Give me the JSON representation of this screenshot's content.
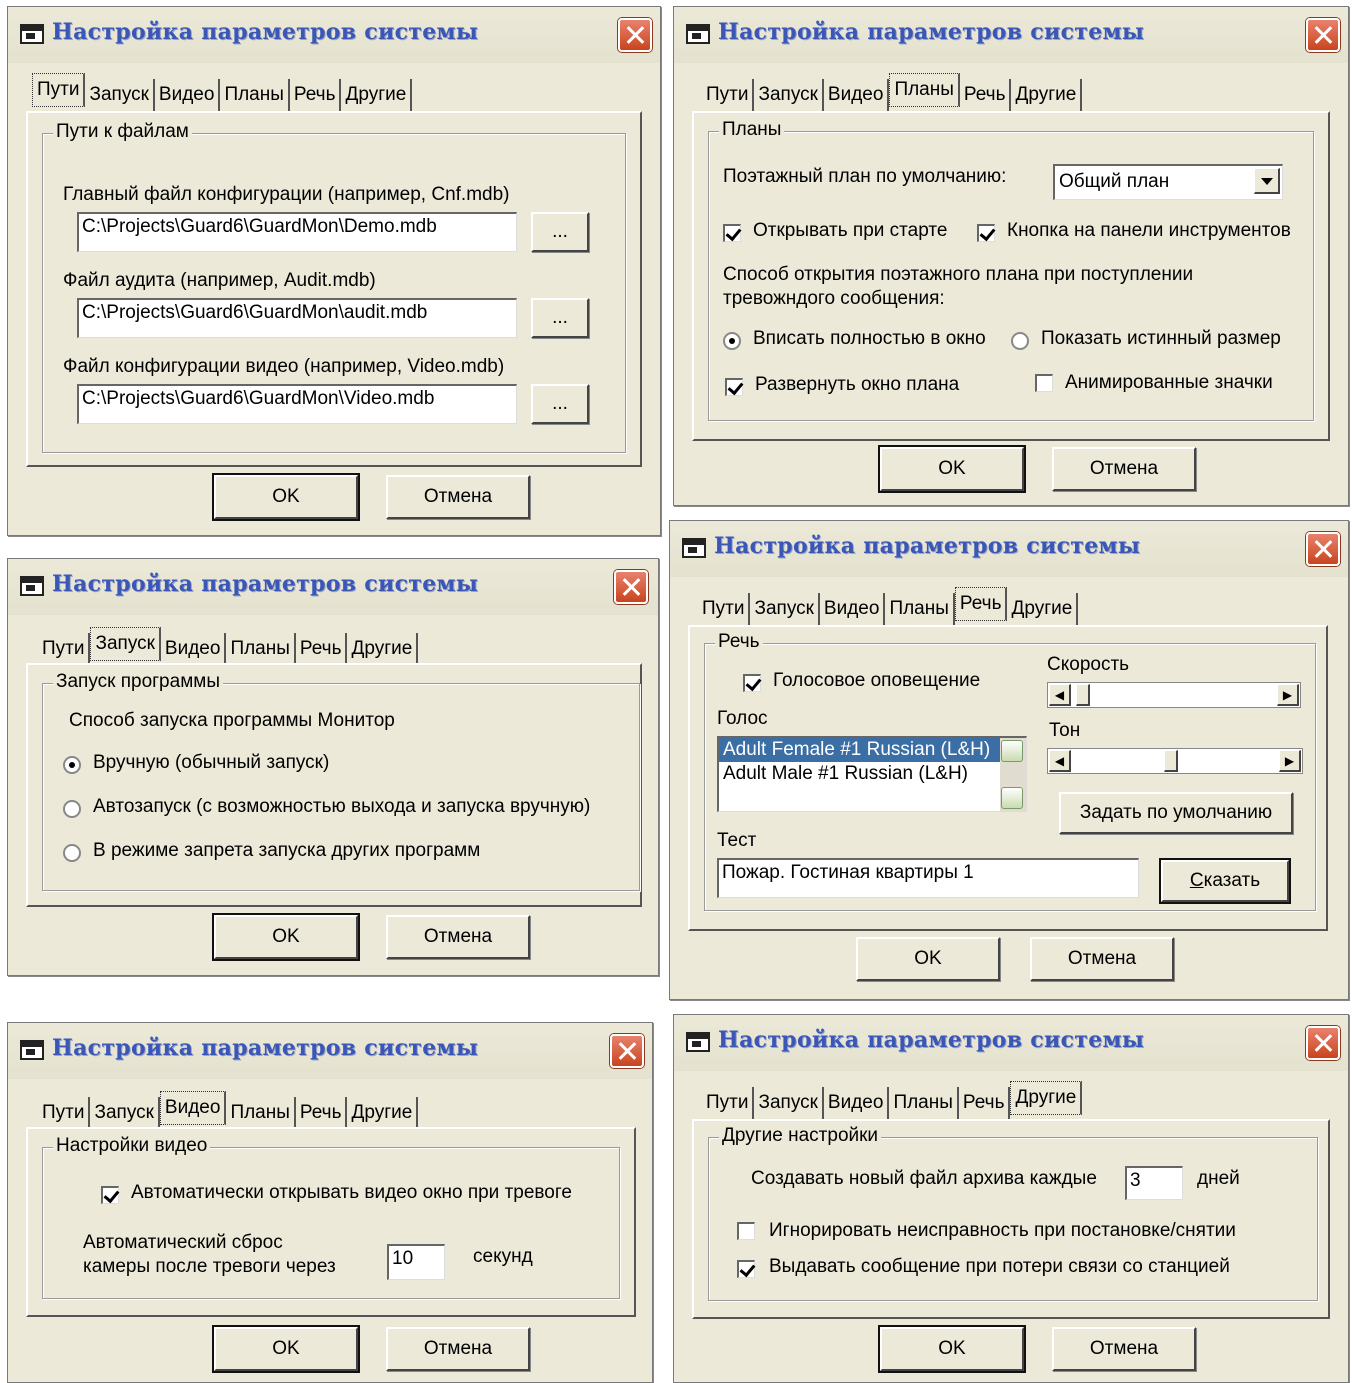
{
  "title": "Настройка параметров системы",
  "tabs": [
    "Пути",
    "Запуск",
    "Видео",
    "Планы",
    "Речь",
    "Другие"
  ],
  "ok_label": "OK",
  "cancel_label": "Отмена",
  "paths": {
    "group": "Пути к файлам",
    "main_label": "Главный файл конфигурации  (например, Cnf.mdb)",
    "main_value": "C:\\Projects\\Guard6\\GuardMon\\Demo.mdb",
    "audit_label": "Файл аудита  (например, Audit.mdb)",
    "audit_value": "C:\\Projects\\Guard6\\GuardMon\\audit.mdb",
    "video_label": "Файл конфигурации видео  (например, Video.mdb)",
    "video_value": "C:\\Projects\\Guard6\\GuardMon\\Video.mdb",
    "browse": "..."
  },
  "plans": {
    "group": "Планы",
    "default_label": "Поэтажный план по умолчанию:",
    "default_value": "Общий план",
    "open_on_start": "Открывать при старте",
    "toolbar_button": "Кнопка на панели инструментов",
    "method_text_1": "Способ открытия поэтажного плана при поступлении",
    "method_text_2": "тревожндого сообщения:",
    "fit_window": "Вписать полностью в окно",
    "true_size": "Показать истинный размер",
    "maximize": "Развернуть окно плана",
    "animated": "Анимированные значки"
  },
  "launch": {
    "group": "Запуск программы",
    "method": "Способ запуска программы Монитор",
    "manual": "Вручную (обычный запуск)",
    "auto": "Автозапуск (с возможностью выхода и запуска вручную)",
    "restrict": "В режиме запрета запуска других программ"
  },
  "speech": {
    "group": "Речь",
    "voice_alert": "Голосовое оповещение",
    "speed": "Скорость",
    "voice": "Голос",
    "tone": "Тон",
    "voices": [
      "Adult Female #1 Russian (L&H)",
      "Adult Male #1 Russian (L&H)"
    ],
    "set_default": "Задать по умолчанию",
    "test": "Тест",
    "test_value": "Пожар. Гостиная квартиры 1",
    "say_prefix": "С",
    "say_rest": "казать"
  },
  "video": {
    "group": "Настройки видео",
    "auto_open": "Автоматически открывать видео окно при тревоге",
    "reset_1": "Автоматический сброс",
    "reset_2": "камеры после тревоги через",
    "seconds_value": "10",
    "seconds": "секунд"
  },
  "other": {
    "group": "Другие настройки",
    "archive_prefix": "Создавать новый файл архива каждые",
    "archive_value": "3",
    "archive_suffix": "дней",
    "ignore_fault": "Игнорировать неисправность при постановке/снятии",
    "lost_connection": "Выдавать сообщение при потери связи со станцией"
  }
}
